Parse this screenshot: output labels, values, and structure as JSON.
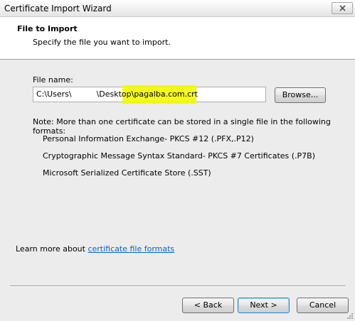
{
  "window": {
    "title": "Certificate Import Wizard",
    "close_icon": "close-icon"
  },
  "header": {
    "title": "File to Import",
    "subtitle": "Specify the file you want to import."
  },
  "file": {
    "label": "File name:",
    "value_prefix": "C:\\Users\\          \\Desktop\\",
    "value_highlighted": "pagalba.com.crt",
    "highlight_color": "#f3f900"
  },
  "browse_label": "Browse...",
  "note": "Note:  More than one certificate can be stored in a single file in the following formats:",
  "formats": [
    "Personal Information Exchange- PKCS #12 (.PFX,.P12)",
    "Cryptographic Message Syntax Standard- PKCS #7 Certificates (.P7B)",
    "Microsoft Serialized Certificate Store (.SST)"
  ],
  "learn_more": {
    "prefix": "Learn more about ",
    "link": "certificate file formats"
  },
  "buttons": {
    "back": "< Back",
    "next": "Next >",
    "cancel": "Cancel"
  }
}
